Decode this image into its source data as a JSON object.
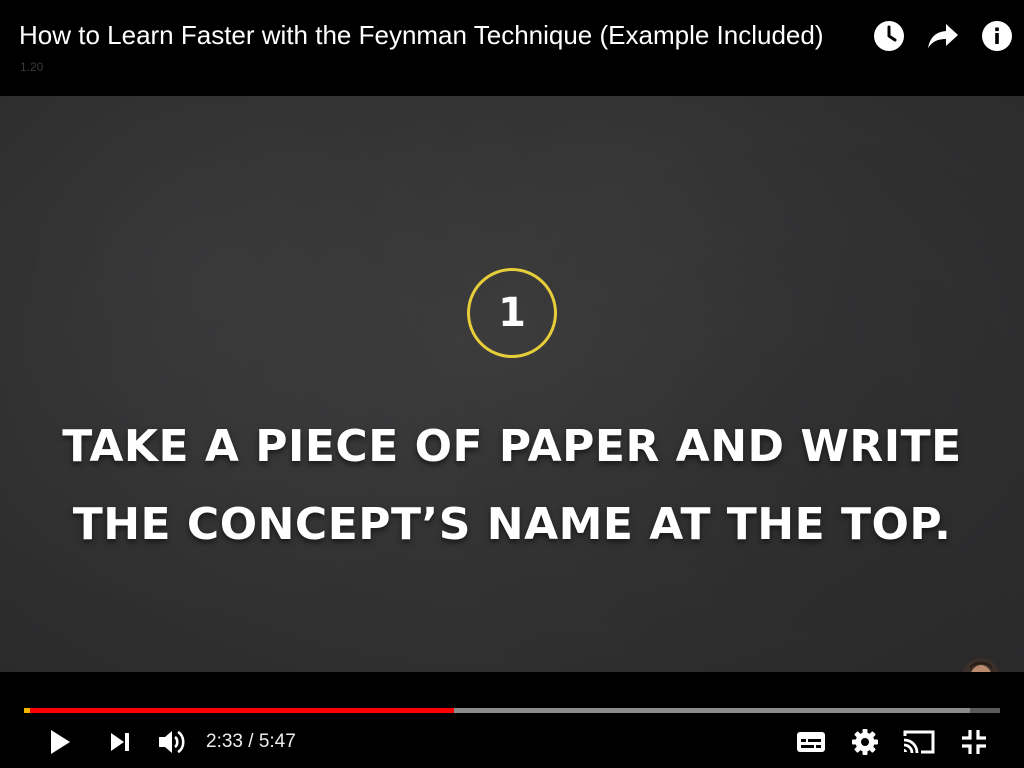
{
  "video": {
    "title": "How to Learn Faster with the Feynman Technique (Example Included)",
    "small_label": "1.20",
    "step_number": "1",
    "caption_line1": "TAKE A PIECE OF PAPER AND WRITE",
    "caption_line2": "THE CONCEPT’S NAME AT THE TOP."
  },
  "top_actions": {
    "icons": [
      "watch-later-icon",
      "share-icon",
      "info-icon"
    ]
  },
  "playback": {
    "current_time": "2:33",
    "separator": " / ",
    "duration": "5:47",
    "played_fraction": 0.441,
    "buffered_fraction": 0.969
  },
  "controls": {
    "icons": [
      "play-icon",
      "next-icon",
      "volume-icon",
      "subtitles-icon",
      "settings-icon",
      "cast-icon",
      "exit-fullscreen-icon"
    ]
  },
  "colors": {
    "progress_played": "#ff0000",
    "progress_buffered": "#8a8a8a",
    "progress_track": "#5a5a5a",
    "step_ring": "#e6cd3a"
  }
}
